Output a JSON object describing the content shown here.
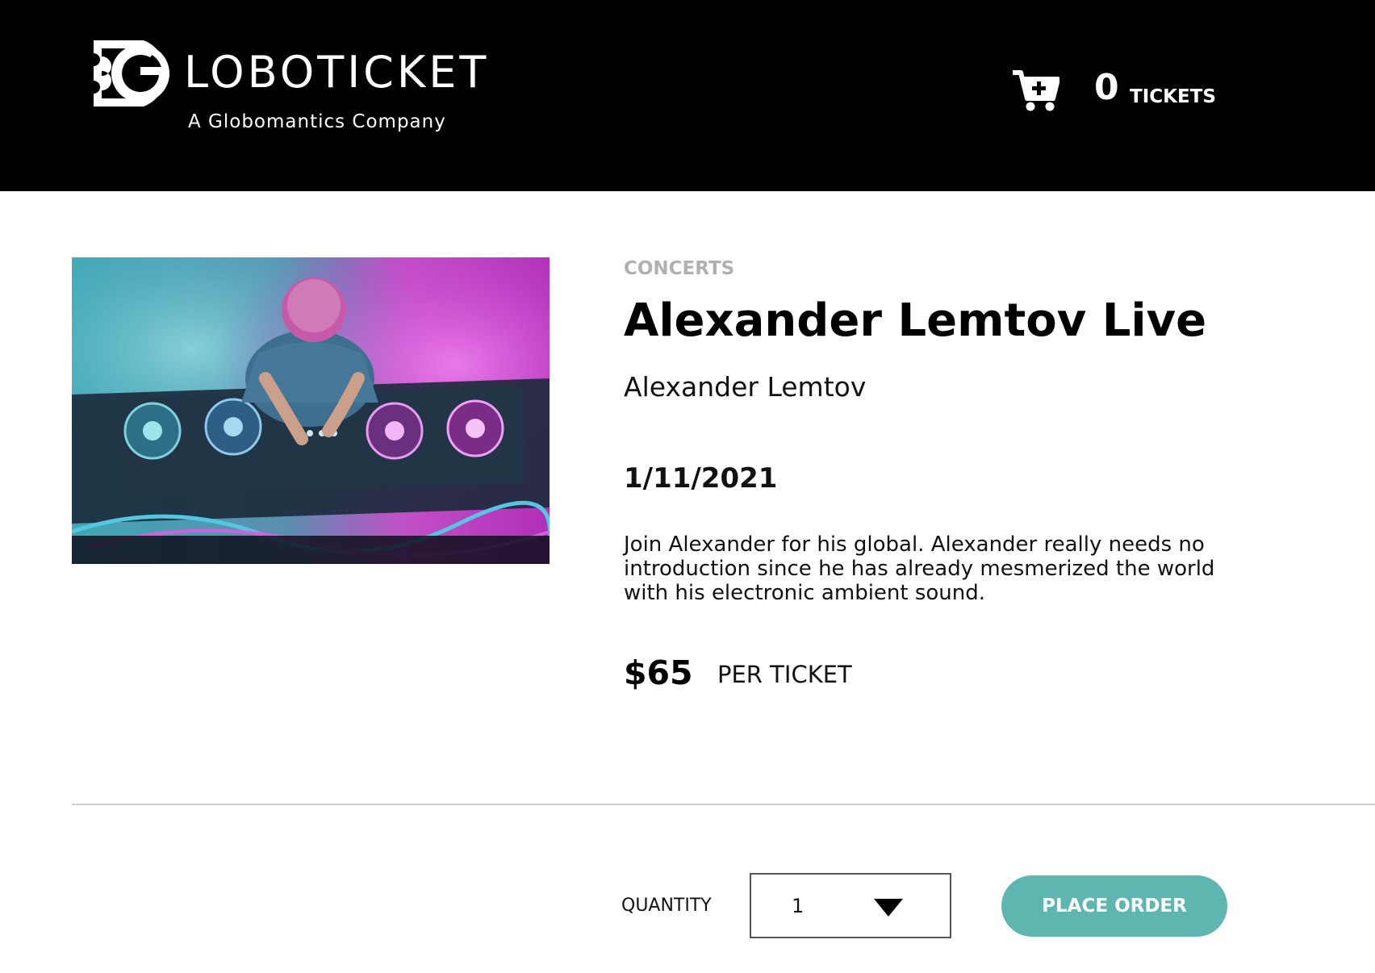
{
  "brand": {
    "name": "LOBOTICKET",
    "tagline": "A Globomantics Company",
    "logo_icon": "ticket-g-logo"
  },
  "cart": {
    "icon": "cart-add-icon",
    "count": "0",
    "label": "TICKETS"
  },
  "event": {
    "image_alt": "DJ performing at a mixing console",
    "category": "CONCERTS",
    "title": "Alexander Lemtov Live",
    "artist": "Alexander Lemtov",
    "date": "1/11/2021",
    "description": "Join Alexander for his global. Alexander really needs no introduction since he has already mesmerized the world with his electronic ambient sound.",
    "price": "$65",
    "price_unit": "PER TICKET"
  },
  "order": {
    "quantity_label": "QUANTITY",
    "quantity_value": "1",
    "dropdown_icon": "chevron-down-icon",
    "button_label": "PLACE ORDER"
  },
  "colors": {
    "header_bg": "#000000",
    "accent": "#5fb5b0",
    "category": "#b0b0b0"
  }
}
